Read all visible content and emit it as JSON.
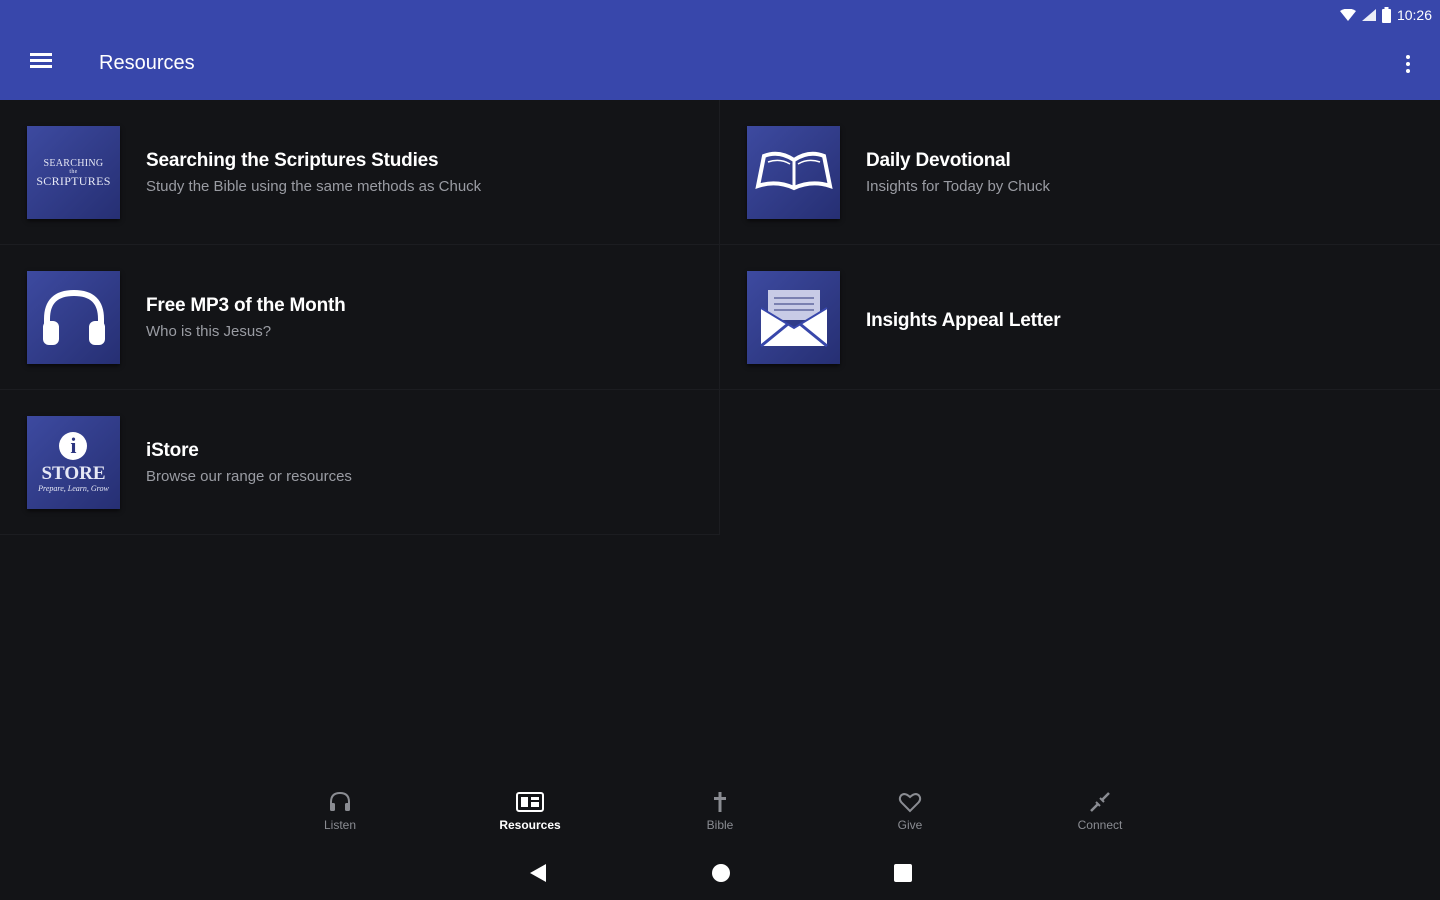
{
  "status_bar": {
    "time": "10:26",
    "icons": [
      "wifi-icon",
      "signal-icon",
      "battery-icon"
    ]
  },
  "app_bar": {
    "title": "Resources",
    "menu_icon": "hamburger-menu-icon",
    "more_icon": "more-vert-icon",
    "background": "#3847ab"
  },
  "resources": [
    {
      "title": "Searching the Scriptures Studies",
      "subtitle": "Study the Bible using the same methods as Chuck",
      "thumb_icon": "searching-scriptures-logo",
      "thumb_text": [
        "SEARCHING",
        "the",
        "SCRIPTURES"
      ]
    },
    {
      "title": "Daily Devotional",
      "subtitle": "Insights for Today by Chuck",
      "thumb_icon": "open-book-icon"
    },
    {
      "title": "Free MP3 of the Month",
      "subtitle": "Who is this Jesus?",
      "thumb_icon": "headphones-icon"
    },
    {
      "title": "Insights Appeal Letter",
      "subtitle": "",
      "thumb_icon": "envelope-icon"
    },
    {
      "title": "iStore",
      "subtitle": "Browse our range or resources",
      "thumb_icon": "istore-logo",
      "thumb_text": [
        "i",
        "STORE",
        "Prepare, Learn, Grow"
      ]
    }
  ],
  "bottom_nav": [
    {
      "label": "Listen",
      "icon": "headphones-icon",
      "active": false
    },
    {
      "label": "Resources",
      "icon": "resources-icon",
      "active": true
    },
    {
      "label": "Bible",
      "icon": "cross-icon",
      "active": false
    },
    {
      "label": "Give",
      "icon": "heart-icon",
      "active": false
    },
    {
      "label": "Connect",
      "icon": "connect-icon",
      "active": false
    }
  ],
  "system_nav": [
    "back-icon",
    "home-icon",
    "recents-icon"
  ]
}
